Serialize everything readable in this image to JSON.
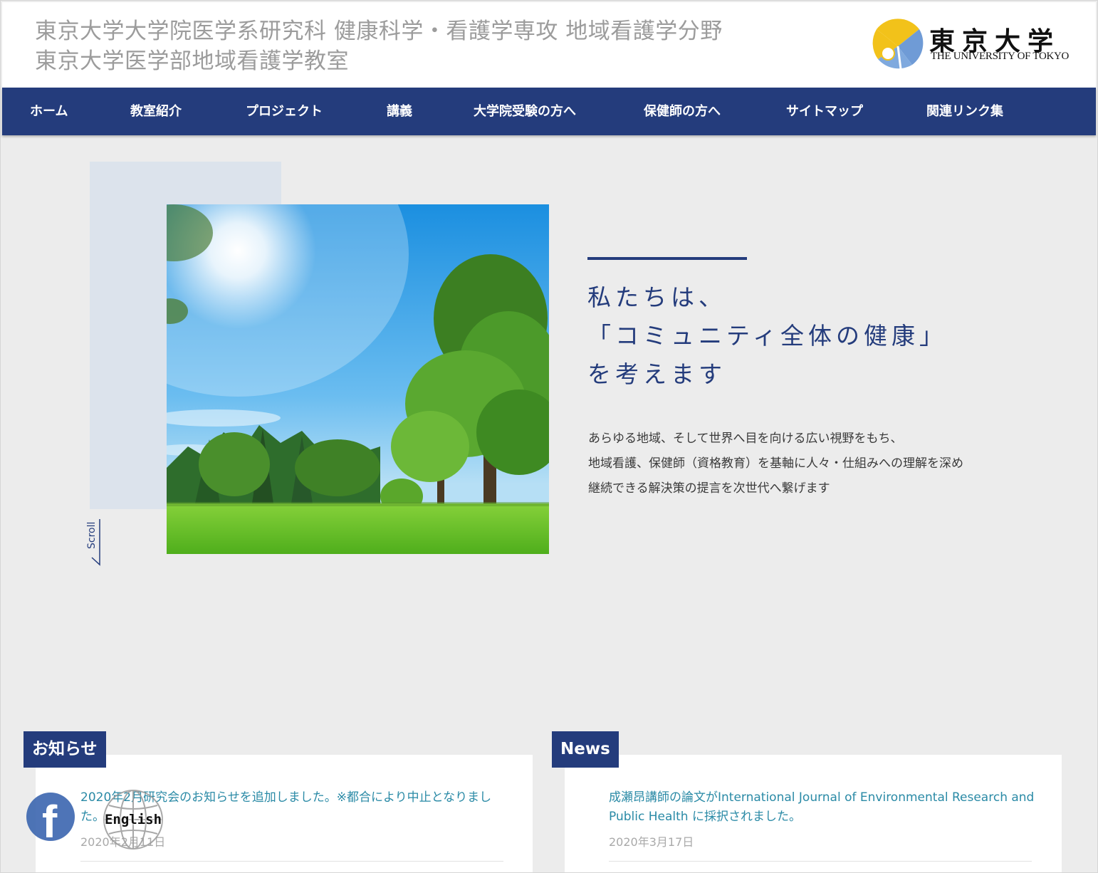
{
  "header": {
    "title_line1": "東京大学大学院医学系研究科 健康科学・看護学専攻 地域看護学分野",
    "title_line2": "東京大学医学部地域看護学教室",
    "logo_jp": "東京大学",
    "logo_en": "THE UNIVERSITY OF TOKYO"
  },
  "nav": {
    "items": [
      {
        "label": "ホーム"
      },
      {
        "label": "教室紹介"
      },
      {
        "label": "プロジェクト"
      },
      {
        "label": "講義"
      },
      {
        "label": "大学院受験の方へ"
      },
      {
        "label": "保健師の方へ"
      },
      {
        "label": "サイトマップ"
      },
      {
        "label": "関連リンク集"
      }
    ]
  },
  "hero": {
    "heading": [
      "私たちは、",
      "「コミュニティ全体の健康」",
      "を考えます"
    ],
    "body": [
      "あらゆる地域、そして世界へ目を向ける広い視野をもち、",
      "地域看護、保健師（資格教育）を基軸に人々・仕組みへの理解を深め",
      "継続できる解決策の提言を次世代へ繋げます"
    ],
    "scroll_label": "Scroll"
  },
  "notices": {
    "tab_label": "お知らせ",
    "items": [
      {
        "text": "2020年2月研究会のお知らせを追加しました。※都合により中止となりました。",
        "date": "2020年2月11日"
      }
    ]
  },
  "news": {
    "tab_label": "News",
    "items": [
      {
        "text": "成瀬昂講師の論文がInternational Journal of Environmental Research and Public Health に採択されました。",
        "date": "2020年3月17日"
      }
    ]
  },
  "floating": {
    "facebook_icon": "facebook-icon",
    "english_label": "English"
  },
  "colors": {
    "brand_navy": "#243c7c",
    "link_teal": "#2a8aa6",
    "page_bg": "#ececec",
    "title_gray": "#9c9c9c"
  }
}
